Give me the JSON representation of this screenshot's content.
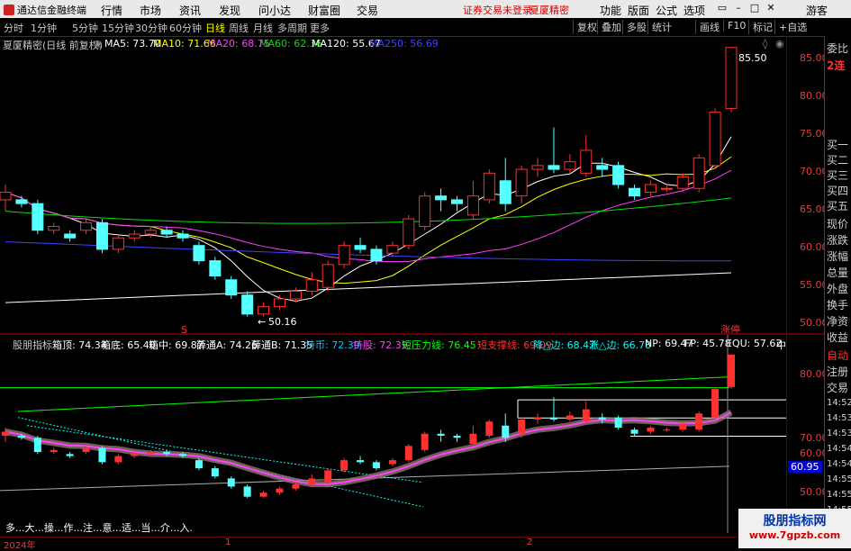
{
  "topbar": {
    "app_title": "通达信金融终端",
    "menus": [
      "行情",
      "市场",
      "资讯",
      "发现",
      "问小达",
      "财富圈",
      "交易"
    ],
    "warn1": "证券交易未登录",
    "warn2": "夏厦精密",
    "right_menus": [
      "功能",
      "版面",
      "公式",
      "选项"
    ],
    "guest": "游客"
  },
  "periods": [
    "分时",
    "1分钟",
    "5分钟",
    "15分钟",
    "30分钟",
    "60分钟",
    "日线",
    "周线",
    "月线",
    "多周期",
    "更多"
  ],
  "active_period": "日线",
  "toolbar": [
    "复权",
    "叠加",
    "多股",
    "统计",
    "画线",
    "F10",
    "标记",
    "+自选"
  ],
  "main": {
    "title": "夏厦精密(日线 前复权)",
    "ma_legend": [
      {
        "label": "MA5: 73.70",
        "color": "#ffffff"
      },
      {
        "label": "MA10: 71.66",
        "color": "#ffff00"
      },
      {
        "label": "MA20: 68.75",
        "color": "#ff40ff"
      },
      {
        "label": "MA60: 62.36",
        "color": "#00e000"
      },
      {
        "label": "MA120: 55.67",
        "color": "#ffffff"
      },
      {
        "label": "MA250: 56.69",
        "color": "#4040ff"
      }
    ],
    "yticks": [
      "85.00",
      "80.00",
      "75.00",
      "70.00",
      "65.00",
      "60.00",
      "55.00",
      "50.00"
    ],
    "high_label": "85.50",
    "low_label": "50.16",
    "zhangting": "涨停",
    "s_mark": "S"
  },
  "sub": {
    "legend": [
      {
        "label": "股朋指标",
        "color": "#c8c8c8"
      },
      {
        "label": "箱顶: 74.34",
        "color": "#ffffff"
      },
      {
        "label": "箱底: 65.40",
        "color": "#ffffff"
      },
      {
        "label": "箱中: 69.87",
        "color": "#ffffff"
      },
      {
        "label": "薛通A: 74.26",
        "color": "#ffffff"
      },
      {
        "label": "薛通B: 71.35",
        "color": "#ffffff"
      },
      {
        "label": "持币: 72.39",
        "color": "#00c8ff"
      },
      {
        "label": "持股: 72.39",
        "color": "#ff40ff"
      },
      {
        "label": "短压力线: 76.45",
        "color": "#00ff00"
      },
      {
        "label": "短支撑线: 69.09",
        "color": "#ff3030"
      },
      {
        "label": "降△边: 68.47",
        "color": "#00ffff"
      },
      {
        "label": "涨△边: 66.78",
        "color": "#00ffff"
      },
      {
        "label": "NP: 69.47",
        "color": "#ffffff"
      },
      {
        "label": "FP: 45.78",
        "color": "#ffffff"
      },
      {
        "label": "EQU: 57.62",
        "color": "#ffffff"
      },
      {
        "label": "中",
        "color": "#ffffff"
      }
    ],
    "yticks": [
      "80.00",
      "70.00",
      "60.00",
      "50.00"
    ],
    "price_box": "60.95",
    "note": "多...大...操...作...注...意...适...当...介...入."
  },
  "right_panel": {
    "top_items": [
      "委比",
      "2连",
      "买一",
      "买二",
      "买三",
      "买四",
      "买五",
      "现价",
      "涨跌",
      "涨幅",
      "总量",
      "外盘",
      "换手",
      "净资",
      "收益"
    ],
    "bottom_items": [
      "自动",
      "注册",
      "交易",
      "14:52",
      "14:53",
      "14:53",
      "14:54",
      "14:54",
      "14:55",
      "14:55",
      "14:55"
    ]
  },
  "dates": [
    "2024年",
    "1",
    "2"
  ],
  "watermark": {
    "line1": "股朋指标网",
    "line2": "www.7gpzb.com"
  },
  "chart_data": {
    "type": "candlestick",
    "ylim": [
      48,
      87
    ],
    "candles": [
      [
        65.5,
        66.5,
        64.0,
        67.5
      ],
      [
        65.5,
        65.0,
        64.5,
        66.0
      ],
      [
        65.0,
        61.5,
        61.0,
        65.5
      ],
      [
        61.5,
        62.0,
        61.0,
        62.5
      ],
      [
        61.0,
        60.5,
        60.0,
        61.5
      ],
      [
        61.5,
        62.5,
        61.0,
        63.0
      ],
      [
        62.5,
        59.0,
        58.5,
        63.0
      ],
      [
        59.0,
        60.5,
        58.5,
        61.0
      ],
      [
        60.5,
        61.0,
        60.0,
        61.5
      ],
      [
        61.0,
        61.5,
        60.5,
        62.0
      ],
      [
        61.5,
        61.0,
        60.5,
        62.0
      ],
      [
        61.0,
        60.5,
        60.0,
        61.5
      ],
      [
        59.5,
        57.5,
        57.0,
        60.0
      ],
      [
        57.5,
        55.5,
        55.0,
        58.0
      ],
      [
        55.0,
        53.0,
        52.5,
        55.5
      ],
      [
        53.0,
        50.5,
        50.16,
        53.5
      ],
      [
        50.5,
        51.5,
        50.2,
        52.0
      ],
      [
        51.5,
        52.5,
        51.0,
        53.0
      ],
      [
        52.5,
        53.5,
        52.0,
        54.0
      ],
      [
        53.5,
        55.0,
        53.0,
        56.0
      ],
      [
        54.0,
        57.0,
        53.5,
        57.5
      ],
      [
        57.0,
        59.5,
        56.5,
        60.0
      ],
      [
        59.5,
        59.0,
        58.5,
        60.5
      ],
      [
        59.0,
        57.5,
        57.0,
        59.5
      ],
      [
        58.5,
        59.5,
        58.0,
        60.0
      ],
      [
        59.5,
        63.0,
        59.0,
        63.5
      ],
      [
        62.0,
        66.0,
        61.5,
        66.5
      ],
      [
        66.0,
        65.5,
        64.0,
        67.0
      ],
      [
        65.5,
        65.0,
        64.0,
        66.0
      ],
      [
        63.5,
        66.0,
        63.0,
        68.0
      ],
      [
        65.5,
        69.0,
        65.0,
        69.5
      ],
      [
        68.0,
        65.0,
        64.0,
        71.0
      ],
      [
        66.0,
        69.5,
        65.0,
        70.0
      ],
      [
        69.5,
        70.0,
        68.5,
        71.0
      ],
      [
        70.0,
        69.5,
        69.0,
        75.0
      ],
      [
        69.5,
        70.5,
        69.0,
        71.5
      ],
      [
        69.0,
        72.0,
        68.5,
        74.0
      ],
      [
        70.0,
        69.5,
        68.5,
        71.0
      ],
      [
        70.0,
        67.5,
        67.0,
        70.5
      ],
      [
        67.0,
        66.0,
        65.5,
        67.5
      ],
      [
        66.5,
        67.5,
        66.0,
        68.0
      ],
      [
        67.0,
        67.0,
        66.5,
        67.5
      ],
      [
        67.0,
        68.5,
        66.5,
        69.0
      ],
      [
        67.0,
        71.0,
        66.5,
        71.5
      ],
      [
        70.0,
        77.0,
        69.5,
        77.5
      ],
      [
        77.5,
        85.5,
        77.0,
        85.5
      ]
    ]
  }
}
